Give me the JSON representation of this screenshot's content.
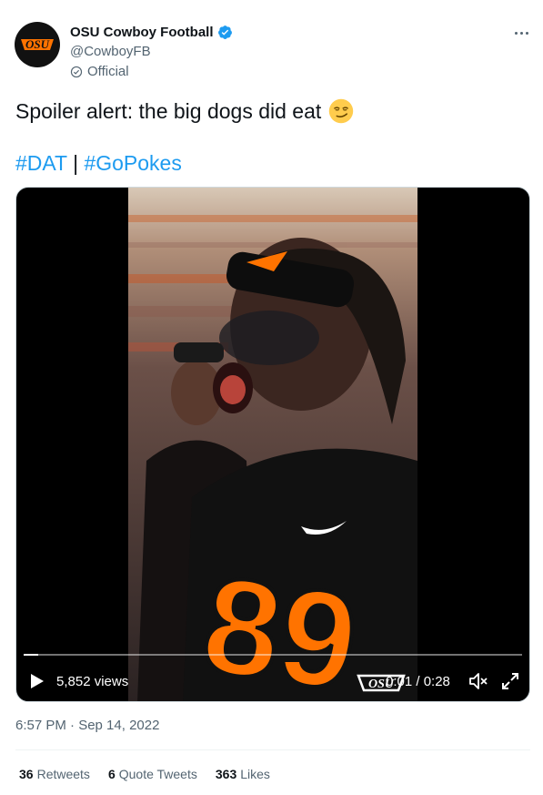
{
  "author": {
    "name": "OSU Cowboy Football",
    "handle": "@CowboyFB",
    "label": "Official",
    "avatar_text": "OSU"
  },
  "tweet": {
    "text": "Spoiler alert: the big dogs did eat",
    "hashtags": [
      "#DAT",
      "#GoPokes"
    ],
    "separator": "|"
  },
  "video": {
    "views": "5,852 views",
    "time": "0:01 / 0:28",
    "watermark": "OSU",
    "progress": 0.03
  },
  "timestamp": "6:57 PM · Sep 14, 2022",
  "stats": [
    {
      "count": "36",
      "label": "Retweets"
    },
    {
      "count": "6",
      "label": "Quote Tweets"
    },
    {
      "count": "363",
      "label": "Likes"
    }
  ],
  "colors": {
    "accent": "#1d9bf0",
    "text": "#0f1419",
    "muted": "#536471",
    "osu_orange": "#ff7300"
  }
}
